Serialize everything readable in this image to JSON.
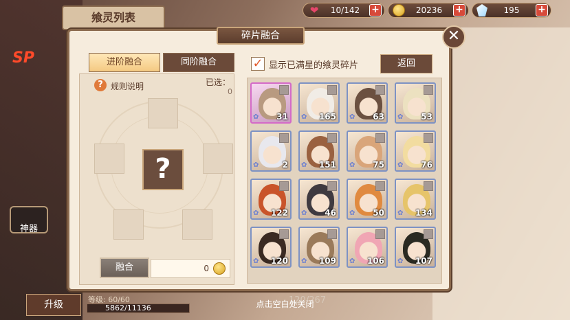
{
  "resources": {
    "stamina": {
      "value": "10/142",
      "icon": "heart-icon"
    },
    "gold": {
      "value": "20236",
      "icon": "coin-icon"
    },
    "diamond": {
      "value": "195",
      "icon": "gem-icon"
    }
  },
  "background": {
    "header_tab": "飨灵列表",
    "sp_label": "SP",
    "artifact_label": "神器",
    "upgrade_label": "升级",
    "level_text": "等级: 60/60",
    "exp_text": "5862/11136",
    "collection_count": "120/267"
  },
  "dialog": {
    "title": "碎片融合",
    "tabs": {
      "advance": "进阶融合",
      "same": "同阶融合"
    },
    "rule_label": "规则说明",
    "selected_label": "已选：",
    "selected_value": "0",
    "center_placeholder": "?",
    "fuse_label": "融合",
    "fuse_cost": "0",
    "show_full_star_label": "显示已满星的飨灵碎片",
    "show_full_star_checked": true,
    "back_label": "返回",
    "close_icon": "close-icon"
  },
  "fragments": [
    {
      "count": "31",
      "frame": "pink",
      "hair": "#b89a80"
    },
    {
      "count": "165",
      "frame": "blue",
      "hair": "#f1ece6"
    },
    {
      "count": "63",
      "frame": "blue",
      "hair": "#6b5040"
    },
    {
      "count": "53",
      "frame": "blue",
      "hair": "#ece1c0"
    },
    {
      "count": "2",
      "frame": "blue",
      "hair": "#e8e8ee"
    },
    {
      "count": "151",
      "frame": "blue",
      "hair": "#9a6140"
    },
    {
      "count": "75",
      "frame": "blue",
      "hair": "#d9a57a"
    },
    {
      "count": "76",
      "frame": "blue",
      "hair": "#f2dca0"
    },
    {
      "count": "122",
      "frame": "blue",
      "hair": "#c9542a"
    },
    {
      "count": "46",
      "frame": "blue",
      "hair": "#3f3a40"
    },
    {
      "count": "50",
      "frame": "blue",
      "hair": "#e08a40"
    },
    {
      "count": "134",
      "frame": "blue",
      "hair": "#e6c46a"
    },
    {
      "count": "120",
      "frame": "blue",
      "hair": "#3a2a22"
    },
    {
      "count": "109",
      "frame": "blue",
      "hair": "#9a7a5a"
    },
    {
      "count": "106",
      "frame": "blue",
      "hair": "#f0a6b4"
    },
    {
      "count": "107",
      "frame": "blue",
      "hair": "#2a2a22"
    }
  ],
  "footer_hint": "点击空白处关闭"
}
